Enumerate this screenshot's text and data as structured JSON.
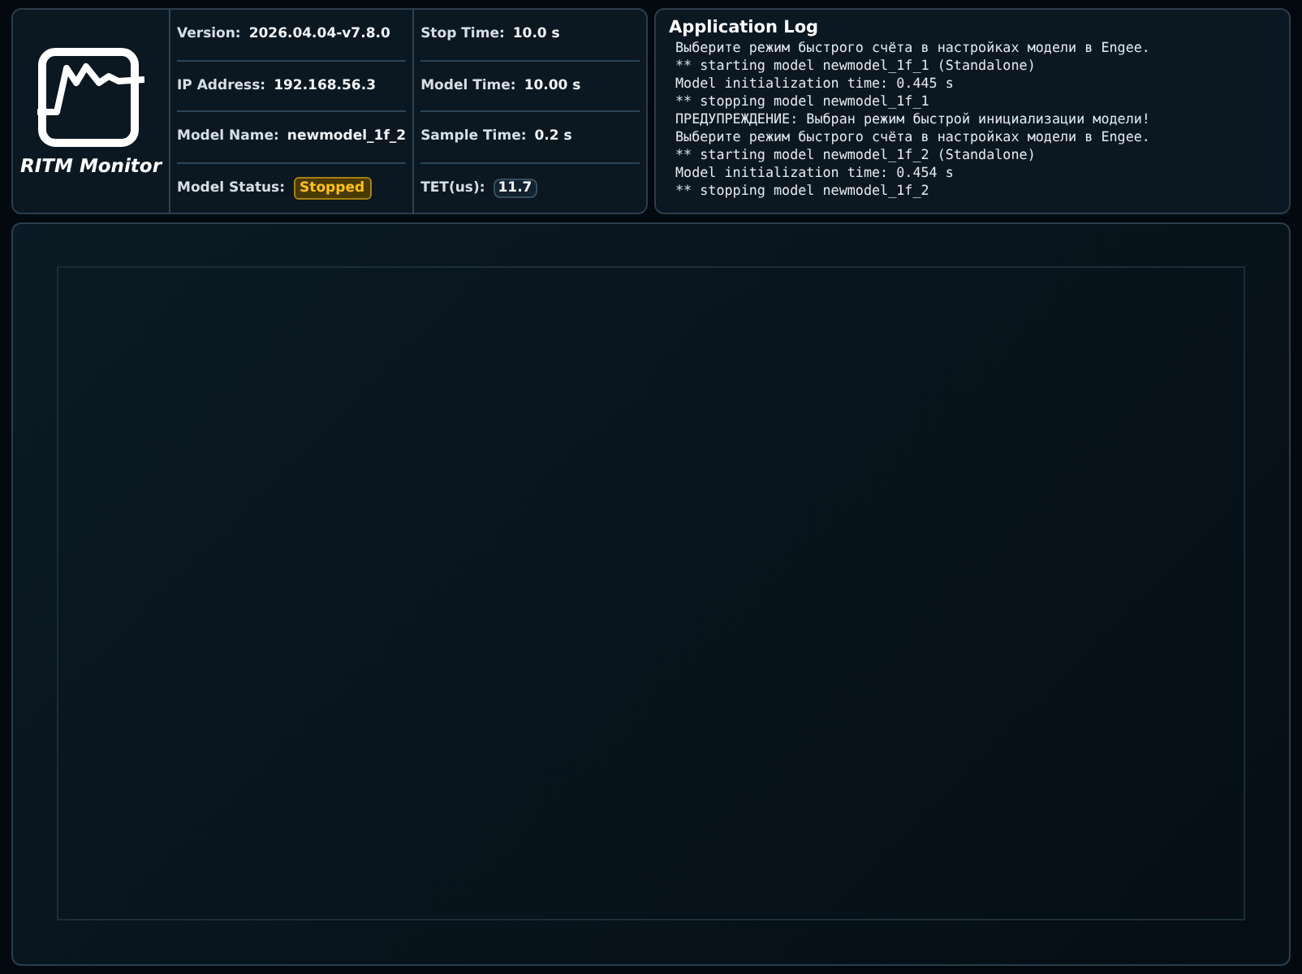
{
  "app": {
    "title": "RITM Monitor"
  },
  "info_columns": [
    [
      {
        "label": "Version:",
        "value": "2026.04.04-v7.8.0"
      },
      {
        "label": "IP Address:",
        "value": "192.168.56.3"
      },
      {
        "label": "Model Name:",
        "value": "newmodel_1f_2"
      },
      {
        "label": "Model Status:",
        "value": "Stopped",
        "kind": "status",
        "running": false
      }
    ],
    [
      {
        "label": "Stop Time:",
        "value": "10.0 s"
      },
      {
        "label": "Model Time:",
        "value": "10.00 s"
      },
      {
        "label": "Sample Time:",
        "value": "0.2 s"
      },
      {
        "label": "TET(us):",
        "value": "11.7",
        "kind": "pill"
      }
    ]
  ],
  "log": {
    "title": "Application Log",
    "lines": [
      "Выберите режим быстрого счёта в настройках модели в Engee.",
      "** starting model newmodel_1f_1 (Standalone)",
      "Model initialization time: 0.445 s",
      "** stopping model newmodel_1f_1",
      "ПРЕДУПРЕЖДЕНИЕ: Выбран режим быстрой инициализации модели!",
      "Выберите режим быстрого счёта в настройках модели в Engee.",
      "** starting model newmodel_1f_2 (Standalone)",
      "Model initialization time: 0.454 s",
      "** stopping model newmodel_1f_2"
    ]
  }
}
